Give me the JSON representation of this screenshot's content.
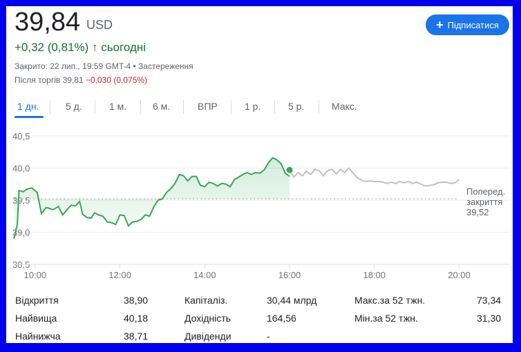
{
  "quote": {
    "price": "39,84",
    "currency": "USD",
    "change_text": "+0,32 (0,81%)",
    "change_arrow": "↑",
    "change_period": "сьогодні",
    "closed_info": "Закрито: 22 лип., 19:59 GMT-4 • Застереження",
    "after_hours_label": "Після торгів",
    "after_hours_price": "39,81",
    "after_hours_change": "−0,030 (0,075%)"
  },
  "follow_button": {
    "icon": "plus-icon",
    "label": "Підписатися"
  },
  "tabs": [
    {
      "label": "1 дн."
    },
    {
      "label": "5 д."
    },
    {
      "label": "1 м."
    },
    {
      "label": "6 м."
    },
    {
      "label": "ВПР"
    },
    {
      "label": "1 р."
    },
    {
      "label": "5 р."
    },
    {
      "label": "Макс."
    }
  ],
  "active_tab": "1 дн.",
  "prev_close": {
    "line1": "Поперед.",
    "line2": "закриття",
    "value": "39,52"
  },
  "colors": {
    "positive": "#137333",
    "negative": "#c5221f",
    "line_green": "#34a853",
    "line_gray": "#bdc1c6",
    "accent": "#1a73e8",
    "frame": "#0000ee"
  },
  "chart_data": {
    "type": "line",
    "y_ticks": [
      "40,5",
      "40,0",
      "39,5",
      "39,0",
      "38,5"
    ],
    "y_tick_values": [
      40.5,
      40.0,
      39.5,
      39.0,
      38.5
    ],
    "x_ticks": [
      "10:00",
      "12:00",
      "14:00",
      "16:00",
      "18:00",
      "20:00"
    ],
    "x_tick_hours": [
      10,
      12,
      14,
      16,
      18,
      20
    ],
    "ylim": [
      38.5,
      40.5
    ],
    "xlim_hours": [
      9.4,
      21.1
    ],
    "reference_line": 39.52,
    "grid": true,
    "series": [
      {
        "session": "regular",
        "color": "#34a853",
        "x": [
          9.5,
          9.58,
          9.62,
          9.72,
          9.8,
          9.92,
          10.05,
          10.15,
          10.25,
          10.3,
          10.42,
          10.55,
          10.65,
          10.75,
          10.85,
          10.95,
          11.05,
          11.12,
          11.22,
          11.32,
          11.4,
          11.5,
          11.6,
          11.7,
          11.8,
          11.9,
          12.0,
          12.1,
          12.2,
          12.3,
          12.4,
          12.5,
          12.6,
          12.7,
          12.8,
          12.9,
          13.0,
          13.1,
          13.2,
          13.3,
          13.4,
          13.5,
          13.6,
          13.7,
          13.8,
          13.9,
          14.0,
          14.1,
          14.2,
          14.3,
          14.4,
          14.5,
          14.6,
          14.7,
          14.8,
          14.9,
          15.0,
          15.1,
          15.2,
          15.3,
          15.4,
          15.5,
          15.6,
          15.7,
          15.8,
          15.9,
          16.0
        ],
        "y": [
          38.9,
          39.12,
          39.65,
          39.63,
          39.67,
          39.69,
          39.62,
          39.29,
          39.38,
          39.38,
          39.35,
          39.4,
          39.27,
          39.35,
          39.42,
          39.41,
          39.48,
          39.28,
          39.23,
          39.22,
          39.3,
          39.27,
          39.25,
          39.16,
          39.15,
          39.12,
          39.27,
          39.26,
          39.1,
          39.16,
          39.17,
          39.2,
          39.27,
          39.25,
          39.4,
          39.5,
          39.52,
          39.62,
          39.68,
          39.76,
          39.9,
          39.88,
          39.8,
          39.87,
          39.87,
          39.73,
          39.71,
          39.78,
          39.76,
          39.72,
          39.76,
          39.75,
          39.71,
          39.82,
          39.86,
          39.9,
          39.93,
          39.9,
          39.93,
          39.92,
          39.97,
          40.08,
          40.16,
          40.13,
          40.07,
          39.92,
          39.87
        ],
        "last_point": 39.97
      },
      {
        "session": "after_hours",
        "color": "#bdc1c6",
        "x": [
          16.0,
          16.1,
          16.2,
          16.3,
          16.4,
          16.5,
          16.6,
          16.7,
          16.8,
          16.9,
          17.0,
          17.1,
          17.2,
          17.3,
          17.4,
          17.5,
          17.6,
          17.7,
          17.8,
          17.9,
          18.0,
          18.1,
          18.2,
          18.3,
          18.4,
          18.5,
          18.6,
          18.7,
          18.8,
          18.9,
          19.0,
          19.1,
          19.2,
          19.3,
          19.4,
          19.5,
          19.6,
          19.7,
          19.8,
          19.9,
          20.0
        ],
        "y": [
          39.97,
          39.86,
          39.93,
          39.88,
          39.95,
          39.9,
          39.98,
          39.96,
          39.88,
          39.96,
          39.98,
          39.91,
          39.98,
          39.93,
          40.0,
          39.92,
          39.85,
          39.81,
          39.79,
          39.8,
          39.79,
          39.79,
          39.78,
          39.76,
          39.78,
          39.76,
          39.79,
          39.77,
          39.79,
          39.76,
          39.78,
          39.75,
          39.72,
          39.73,
          39.74,
          39.77,
          39.78,
          39.78,
          39.76,
          39.77,
          39.82
        ]
      }
    ]
  },
  "stats": [
    {
      "label": "Відкриття",
      "value": "38,90"
    },
    {
      "label": "Найвища",
      "value": "40,18"
    },
    {
      "label": "Найнижча",
      "value": "38,71"
    },
    {
      "label": "Капіталіз.",
      "value": "30,44 млрд"
    },
    {
      "label": "Дохідність",
      "value": "164,56"
    },
    {
      "label": "Дивіденди",
      "value": "-"
    },
    {
      "label": "Макс.за 52 тжн.",
      "value": "73,34"
    },
    {
      "label": "Мін.за 52 тжн.",
      "value": "31,30"
    }
  ]
}
